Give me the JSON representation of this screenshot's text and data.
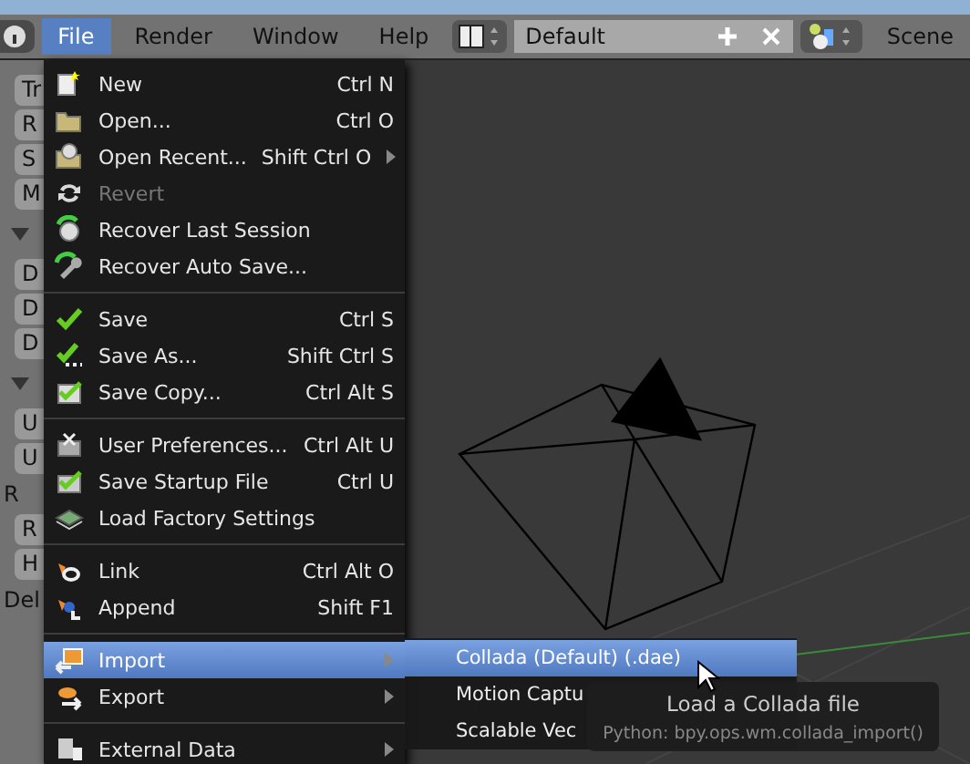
{
  "header": {
    "menus": [
      {
        "label": "File",
        "selected": true
      },
      {
        "label": "Render",
        "selected": false
      },
      {
        "label": "Window",
        "selected": false
      },
      {
        "label": "Help",
        "selected": false
      }
    ],
    "layout": "Default",
    "scene": "Scene"
  },
  "left_panel": [
    {
      "kind": "button",
      "label": "Tr"
    },
    {
      "kind": "button",
      "label": "R"
    },
    {
      "kind": "button",
      "label": "S"
    },
    {
      "kind": "button",
      "label": "M"
    },
    {
      "kind": "arrow"
    },
    {
      "kind": "button",
      "label": "D"
    },
    {
      "kind": "button",
      "label": "D"
    },
    {
      "kind": "button",
      "label": "D"
    },
    {
      "kind": "arrow"
    },
    {
      "kind": "button",
      "label": "U"
    },
    {
      "kind": "button",
      "label": "U"
    },
    {
      "kind": "label",
      "label": "R"
    },
    {
      "kind": "button",
      "label": "R"
    },
    {
      "kind": "button",
      "label": "H"
    },
    {
      "kind": "label",
      "label": "Del"
    }
  ],
  "file_menu": [
    {
      "label": "New",
      "shortcut": "Ctrl N",
      "disabled": false,
      "submenu": false,
      "selected": false,
      "separator_before": false
    },
    {
      "label": "Open...",
      "shortcut": "Ctrl O",
      "disabled": false,
      "submenu": false,
      "selected": false,
      "separator_before": false
    },
    {
      "label": "Open Recent...",
      "shortcut": "Shift Ctrl O",
      "disabled": false,
      "submenu": true,
      "selected": false,
      "separator_before": false
    },
    {
      "label": "Revert",
      "disabled": true,
      "submenu": false,
      "selected": false,
      "separator_before": false
    },
    {
      "label": "Recover Last Session",
      "disabled": false,
      "submenu": false,
      "selected": false,
      "separator_before": false
    },
    {
      "label": "Recover Auto Save...",
      "disabled": false,
      "submenu": false,
      "selected": false,
      "separator_before": false
    },
    {
      "label": "Save",
      "shortcut": "Ctrl S",
      "disabled": false,
      "submenu": false,
      "selected": false,
      "separator_before": true
    },
    {
      "label": "Save As...",
      "shortcut": "Shift Ctrl S",
      "disabled": false,
      "submenu": false,
      "selected": false,
      "separator_before": false
    },
    {
      "label": "Save Copy...",
      "shortcut": "Ctrl Alt S",
      "disabled": false,
      "submenu": false,
      "selected": false,
      "separator_before": false
    },
    {
      "label": "User Preferences...",
      "shortcut": "Ctrl Alt U",
      "disabled": false,
      "submenu": false,
      "selected": false,
      "separator_before": true
    },
    {
      "label": "Save Startup File",
      "shortcut": "Ctrl U",
      "disabled": false,
      "submenu": false,
      "selected": false,
      "separator_before": false
    },
    {
      "label": "Load Factory Settings",
      "disabled": false,
      "submenu": false,
      "selected": false,
      "separator_before": false
    },
    {
      "label": "Link",
      "shortcut": "Ctrl Alt O",
      "disabled": false,
      "submenu": false,
      "selected": false,
      "separator_before": true
    },
    {
      "label": "Append",
      "shortcut": "Shift F1",
      "disabled": false,
      "submenu": false,
      "selected": false,
      "separator_before": false
    },
    {
      "label": "Import",
      "disabled": false,
      "submenu": true,
      "selected": true,
      "separator_before": true
    },
    {
      "label": "Export",
      "disabled": false,
      "submenu": true,
      "selected": false,
      "separator_before": false
    },
    {
      "label": "External Data",
      "disabled": false,
      "submenu": true,
      "selected": false,
      "separator_before": true
    }
  ],
  "import_menu": [
    {
      "label": "Collada (Default) (.dae)",
      "selected": true
    },
    {
      "label": "Motion Captu",
      "selected": false
    },
    {
      "label": "Scalable Vec",
      "selected": false
    }
  ],
  "tooltip": {
    "title": "Load a Collada file",
    "python": "Python: bpy.ops.wm.collada_import()"
  }
}
